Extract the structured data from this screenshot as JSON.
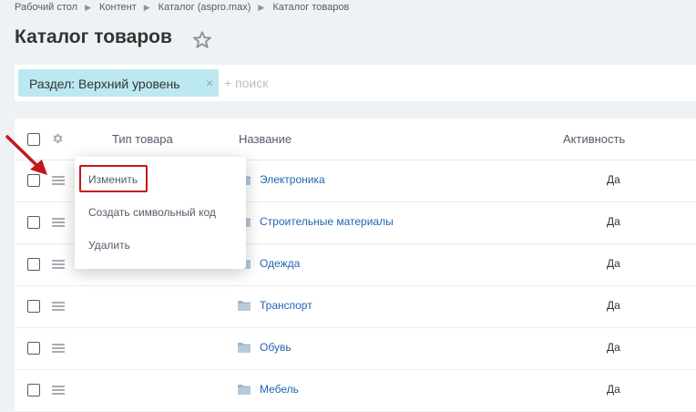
{
  "breadcrumb": {
    "items": [
      "Рабочий стол",
      "Контент",
      "Каталог (aspro.max)",
      "Каталог товаров"
    ]
  },
  "page": {
    "title": "Каталог товаров"
  },
  "filter": {
    "chip_label": "Раздел: Верхний уровень",
    "chip_close": "×",
    "search_placeholder": "+ поиск"
  },
  "grid": {
    "columns": [
      "Тип товара",
      "Название",
      "Активность"
    ],
    "rows": [
      {
        "name": "Электроника",
        "active": "Да"
      },
      {
        "name": "Строительные материалы",
        "active": "Да"
      },
      {
        "name": "Одежда",
        "active": "Да"
      },
      {
        "name": "Транспорт",
        "active": "Да"
      },
      {
        "name": "Обувь",
        "active": "Да"
      },
      {
        "name": "Мебель",
        "active": "Да"
      }
    ]
  },
  "context_menu": {
    "items": [
      "Изменить",
      "Создать символьный код",
      "Удалить"
    ]
  },
  "colors": {
    "link": "#2067b0",
    "chip_bg": "#bce8f1",
    "highlight": "#c4171a",
    "background": "#eef2f4"
  },
  "icons": [
    "star-icon",
    "gear-icon",
    "drag-handle-icon",
    "folder-icon",
    "chip-close-icon",
    "chevron-right-icon"
  ]
}
